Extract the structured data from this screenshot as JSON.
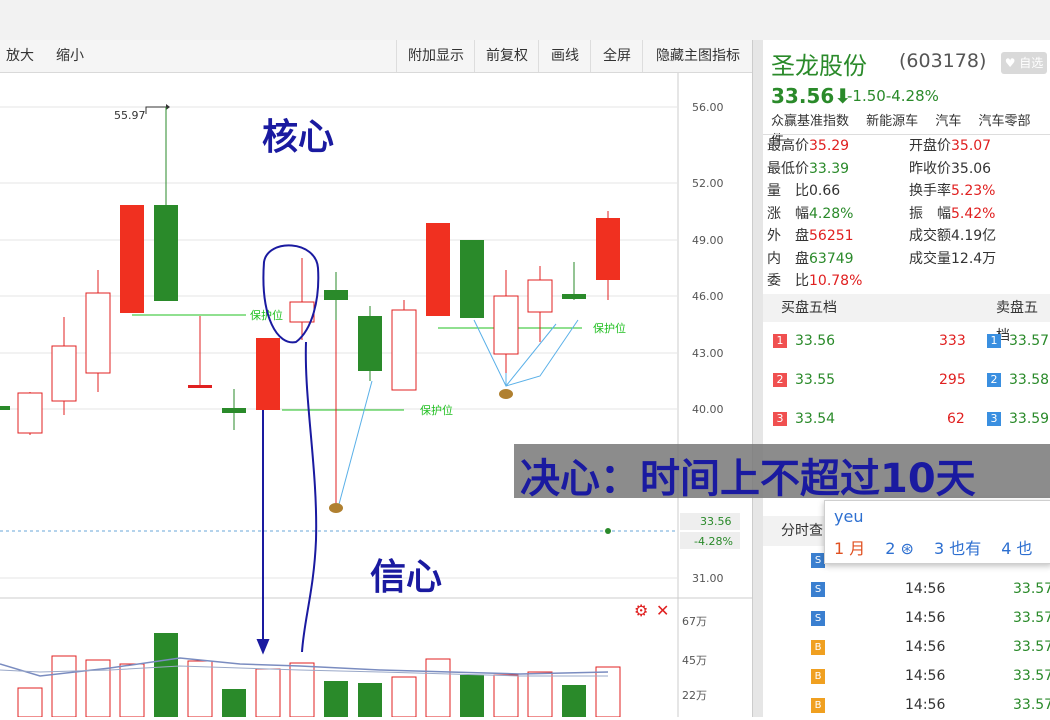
{
  "toolbar": {
    "left_buttons": [
      "放大",
      "缩小"
    ],
    "right_buttons": [
      "附加显示",
      "前复权",
      "画线",
      "全屏",
      "隐藏主图指标"
    ]
  },
  "chart": {
    "price_axis": [
      "56.00",
      "52.00",
      "49.00",
      "46.00",
      "43.00",
      "40.00",
      "31.00"
    ],
    "current_price_tag": "33.56",
    "current_change_tag": "-4.28%",
    "high_marker": "55.97",
    "volume_axis": [
      "67万",
      "45万",
      "22万"
    ],
    "protect_label": "保护位",
    "annotations": {
      "core": "核心",
      "confidence": "信心"
    }
  },
  "panel": {
    "name": "圣龙股份",
    "code": "(603178)",
    "fav_label": "自选",
    "price": "33.56",
    "arrow": "⬇",
    "change": "-1.50",
    "change_pct": "-4.28%",
    "tags": [
      "众赢基准指数",
      "新能源车",
      "汽车",
      "汽车零部件"
    ],
    "stats": [
      {
        "l_label": "最高价",
        "l_value": "35.29",
        "l_color": "red",
        "r_label": "开盘价",
        "r_value": "35.07",
        "r_color": "red"
      },
      {
        "l_label": "最低价",
        "l_value": "33.39",
        "l_color": "green",
        "r_label": "昨收价",
        "r_value": "35.06",
        "r_color": "dark"
      },
      {
        "l_label": "量　比",
        "l_value": "0.66",
        "l_color": "dark",
        "r_label": "换手率",
        "r_value": "5.23%",
        "r_color": "red"
      },
      {
        "l_label": "涨　幅",
        "l_value": "4.28%",
        "l_color": "green",
        "r_label": "振　幅",
        "r_value": "5.42%",
        "r_color": "red"
      },
      {
        "l_label": "外　盘",
        "l_value": "56251",
        "l_color": "red",
        "r_label": "成交额",
        "r_value": "4.19亿",
        "r_color": "dark"
      },
      {
        "l_label": "内　盘",
        "l_value": "63749",
        "l_color": "green",
        "r_label": "成交量",
        "r_value": "12.4万",
        "r_color": "dark"
      },
      {
        "l_label": "委　比",
        "l_value": "10.78%",
        "l_color": "red",
        "r_label": "",
        "r_value": "",
        "r_color": "dark"
      }
    ],
    "buy_header": "买盘五档",
    "sell_header": "卖盘五档",
    "book": [
      {
        "n": "1",
        "bid": "33.56",
        "vol": "333",
        "ask": "33.57"
      },
      {
        "n": "2",
        "bid": "33.55",
        "vol": "295",
        "ask": "33.58"
      },
      {
        "n": "3",
        "bid": "33.54",
        "vol": "62",
        "ask": "33.59"
      }
    ],
    "trades_tab": "分时查",
    "trades": [
      {
        "side": "S",
        "time": "14:56",
        "price": "33.57"
      },
      {
        "side": "S",
        "time": "14:56",
        "price": "33.57"
      },
      {
        "side": "S",
        "time": "14:56",
        "price": "33.57"
      },
      {
        "side": "B",
        "time": "14:56",
        "price": "33.57"
      },
      {
        "side": "B",
        "time": "14:56",
        "price": "33.57"
      },
      {
        "side": "B",
        "time": "14:56",
        "price": "33.57"
      }
    ]
  },
  "overlay": {
    "text": "决心：时间上不超过10天"
  },
  "ime": {
    "input": "yeu",
    "candidates": [
      "1 月",
      "2 ⊛",
      "3 也有",
      "4 也"
    ]
  }
}
